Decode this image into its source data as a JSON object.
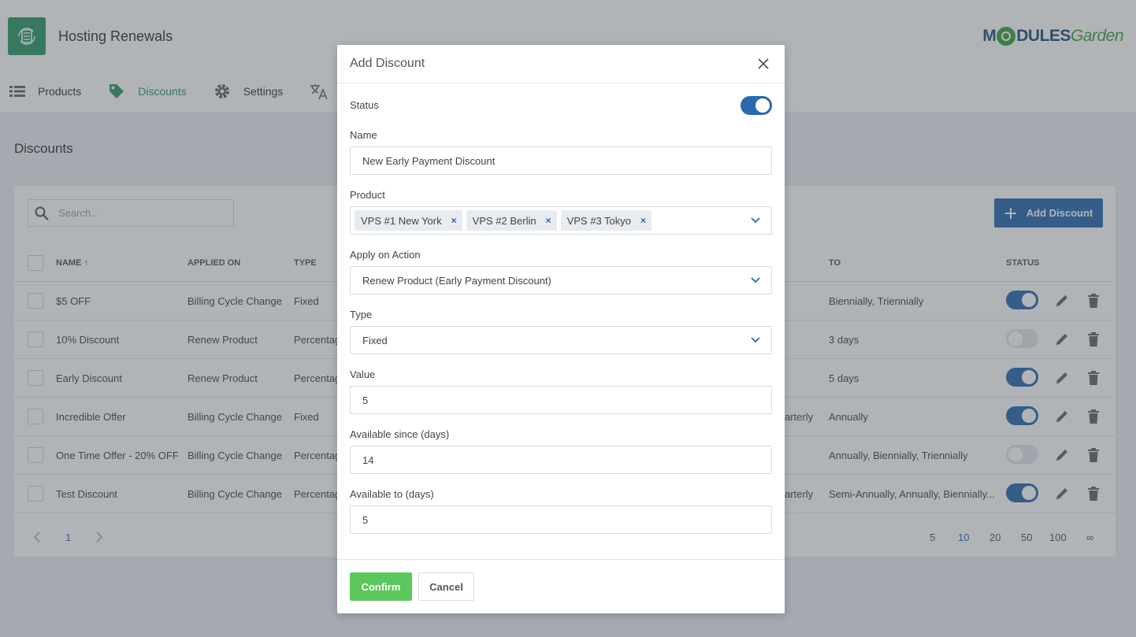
{
  "app": {
    "title": "Hosting Renewals",
    "brand_part1": "M",
    "brand_part2": "DULES",
    "brand_part3": "Garden"
  },
  "nav": {
    "products": "Products",
    "discounts": "Discounts",
    "settings": "Settings"
  },
  "page": {
    "heading": "Discounts"
  },
  "search": {
    "placeholder": "Search..."
  },
  "add_button": {
    "label": "Add Discount"
  },
  "table": {
    "headers": {
      "name": "NAME",
      "applied_on": "APPLIED ON",
      "type": "TYPE",
      "to": "TO",
      "status": "STATUS"
    },
    "rows": [
      {
        "name": "$5 OFF",
        "applied_on": "Billing Cycle Change",
        "type": "Fixed",
        "from_tail": "",
        "to": "Biennially, Triennially",
        "status": true
      },
      {
        "name": "10% Discount",
        "applied_on": "Renew Product",
        "type": "Percentag",
        "from_tail": "",
        "to": "3 days",
        "status": false
      },
      {
        "name": "Early Discount",
        "applied_on": "Renew Product",
        "type": "Percentag",
        "from_tail": "",
        "to": "5 days",
        "status": true
      },
      {
        "name": "Incredible Offer",
        "applied_on": "Billing Cycle Change",
        "type": "Fixed",
        "from_tail": "arterly",
        "to": "Annually",
        "status": true
      },
      {
        "name": "One Time Offer - 20% OFF",
        "applied_on": "Billing Cycle Change",
        "type": "Percentag",
        "from_tail": "",
        "to": "Annually, Biennially, Triennially",
        "status": false
      },
      {
        "name": "Test Discount",
        "applied_on": "Billing Cycle Change",
        "type": "Percentag",
        "from_tail": "arterly",
        "to": "Semi-Annually, Annually, Biennially...",
        "status": true
      }
    ]
  },
  "pagination": {
    "current_page": "1",
    "page_sizes": [
      "5",
      "10",
      "20",
      "50",
      "100",
      "∞"
    ],
    "active_page_size": "10"
  },
  "modal": {
    "title": "Add Discount",
    "status_label": "Status",
    "status_on": true,
    "name_label": "Name",
    "name_value": "New Early Payment Discount",
    "product_label": "Product",
    "products": [
      "VPS #1 New York",
      "VPS #2 Berlin",
      "VPS #3 Tokyo"
    ],
    "chip_remove": "×",
    "apply_label": "Apply on Action",
    "apply_value": "Renew Product (Early Payment Discount)",
    "type_label": "Type",
    "type_value": "Fixed",
    "value_label": "Value",
    "value_value": "5",
    "since_label": "Available since (days)",
    "since_value": "14",
    "to_label": "Available to (days)",
    "to_value": "5",
    "confirm": "Confirm",
    "cancel": "Cancel"
  },
  "colors": {
    "accent": "#2969b0",
    "green": "#2e9a6a",
    "confirm": "#5cc75c"
  }
}
